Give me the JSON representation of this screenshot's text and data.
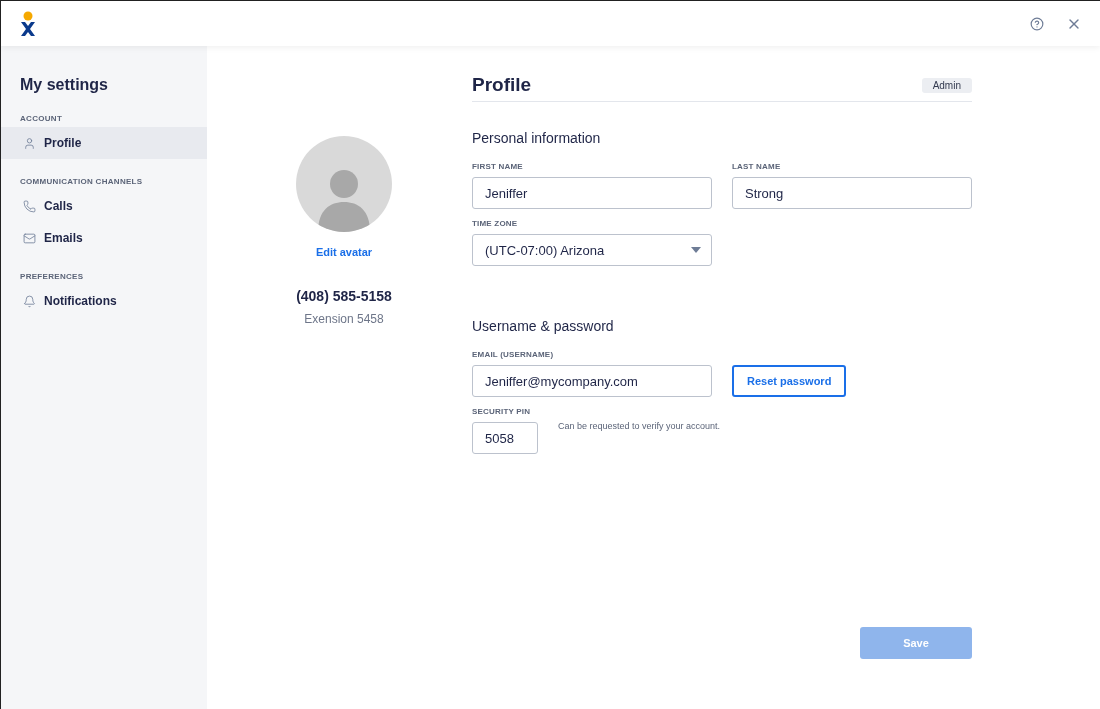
{
  "sidebar": {
    "title": "My settings",
    "sections": [
      {
        "heading": "ACCOUNT",
        "items": [
          {
            "label": "Profile",
            "selected": true
          }
        ]
      },
      {
        "heading": "COMMUNICATION CHANNELS",
        "items": [
          {
            "label": "Calls",
            "selected": false
          },
          {
            "label": "Emails",
            "selected": false
          }
        ]
      },
      {
        "heading": "PREFERENCES",
        "items": [
          {
            "label": "Notifications",
            "selected": false
          }
        ]
      }
    ]
  },
  "profile_card": {
    "edit_avatar": "Edit avatar",
    "phone": "(408) 585-5158",
    "extension": "Exension 5458"
  },
  "page": {
    "title": "Profile",
    "badge": "Admin"
  },
  "personal_information": {
    "heading": "Personal information",
    "first_name": {
      "label": "FIRST NAME",
      "value": "Jeniffer"
    },
    "last_name": {
      "label": "LAST NAME",
      "value": "Strong"
    },
    "time_zone": {
      "label": "TIME ZONE",
      "value": "(UTC-07:00) Arizona"
    }
  },
  "username_password": {
    "heading": "Username & password",
    "email": {
      "label": "EMAIL (USERNAME)",
      "value": "Jeniffer@mycompany.com"
    },
    "reset_button": "Reset password",
    "security_pin": {
      "label": "SECURITY PIN",
      "value": "5058",
      "hint": "Can be requested to verify your account."
    }
  },
  "save_button": {
    "label": "Save",
    "disabled": true
  }
}
